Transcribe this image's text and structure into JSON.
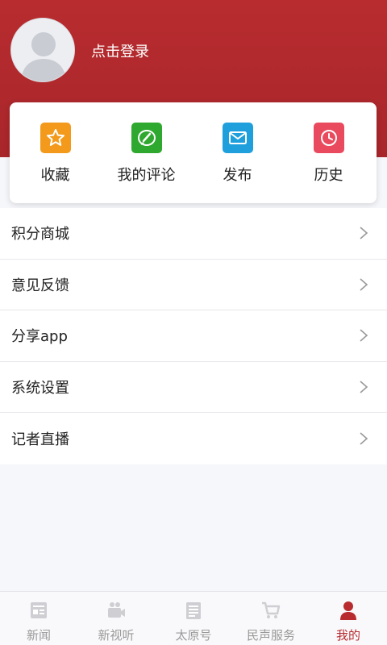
{
  "profile": {
    "login_label": "点击登录"
  },
  "quick_actions": [
    {
      "label": "收藏",
      "icon": "star-icon",
      "color": "#f39a1c"
    },
    {
      "label": "我的评论",
      "icon": "comment-icon",
      "color": "#2fa82f"
    },
    {
      "label": "发布",
      "icon": "mail-icon",
      "color": "#1f9fdc"
    },
    {
      "label": "历史",
      "icon": "clock-icon",
      "color": "#e94a5e"
    }
  ],
  "menu": [
    {
      "label": "积分商城"
    },
    {
      "label": "意见反馈"
    },
    {
      "label": "分享app"
    },
    {
      "label": "系统设置"
    },
    {
      "label": "记者直播"
    }
  ],
  "tabbar": [
    {
      "label": "新闻",
      "icon": "news-icon",
      "active": false
    },
    {
      "label": "新视听",
      "icon": "video-icon",
      "active": false
    },
    {
      "label": "太原号",
      "icon": "newspaper-icon",
      "active": false
    },
    {
      "label": "民声服务",
      "icon": "cart-icon",
      "active": false
    },
    {
      "label": "我的",
      "icon": "person-icon",
      "active": true
    }
  ],
  "colors": {
    "brand": "#b82c2f",
    "inactive": "#9a9a9a"
  }
}
